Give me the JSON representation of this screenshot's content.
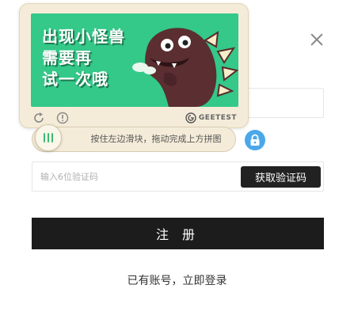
{
  "captcha": {
    "image_text_lines": [
      "出现小怪兽",
      "需要再",
      "试一次哦"
    ],
    "brand": "GEETEST",
    "slider_hint": "按住左边滑块，拖动完成上方拼图",
    "icons": {
      "refresh": "refresh-icon",
      "info": "info-icon",
      "brand_mark": "geetest-logo-icon",
      "knob": "grip-icon",
      "lock": "lock-icon"
    },
    "colors": {
      "image_bg": "#34c889",
      "panel_bg": "#f4ecd9",
      "lock_bg": "#4aa8ea",
      "knob_grip": "#3fb96f"
    }
  },
  "form": {
    "sms_code_placeholder": "输入6位验证码",
    "sms_code_value": "",
    "get_code_button": "获取验证码",
    "register_button": "注 册",
    "login_link": "已有账号，立即登录"
  },
  "dialog": {
    "close_icon": "close-icon"
  }
}
